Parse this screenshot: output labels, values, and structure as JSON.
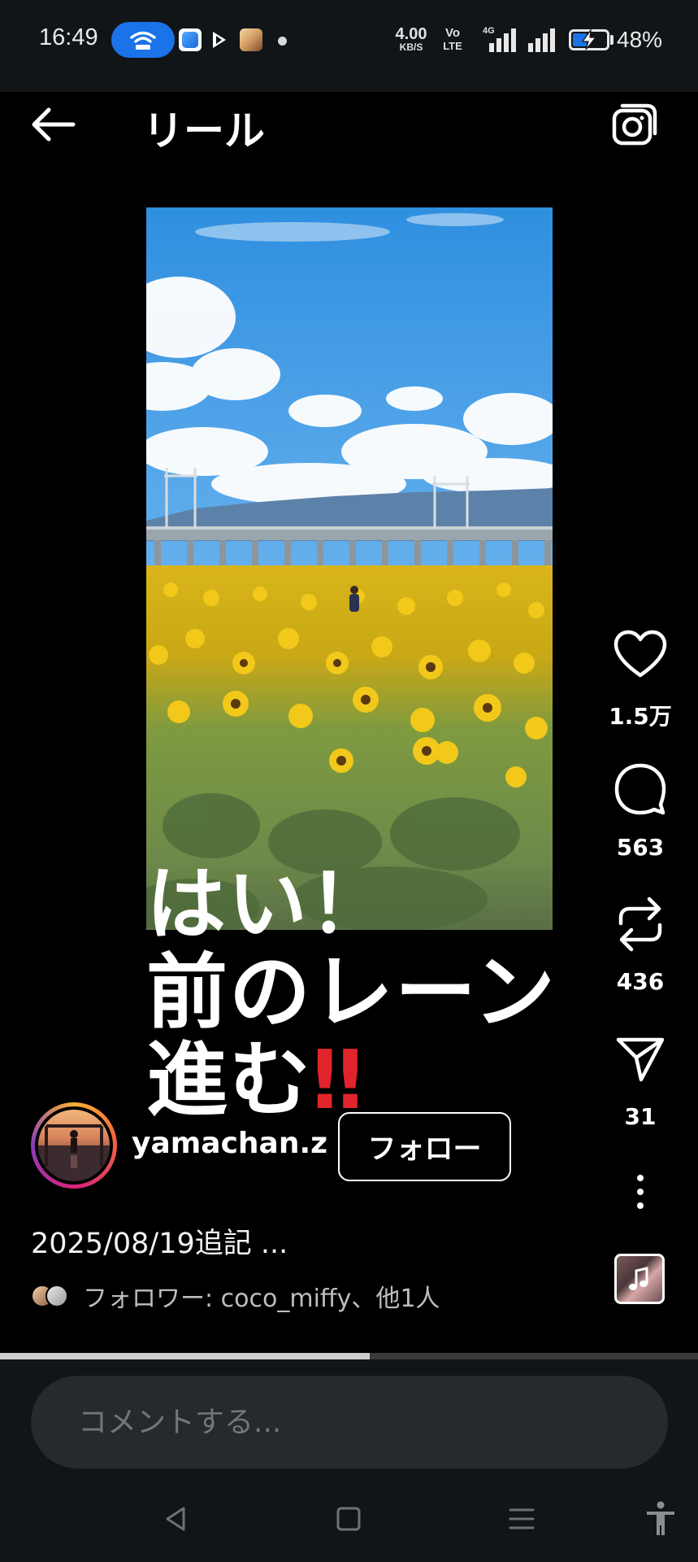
{
  "status_bar": {
    "time": "16:49",
    "net_speed_value": "4.00",
    "net_speed_unit": "KB/S",
    "volte_top": "Vo",
    "volte_bottom": "LTE",
    "network_type": "4G",
    "battery_percent_label": "48%",
    "battery_level": 0.48,
    "accent_color": "#1a73e8"
  },
  "header": {
    "title": "リール",
    "back_icon": "arrow-left-icon",
    "camera_icon": "camera-icon"
  },
  "video": {
    "overlay_caption": {
      "line1": "はい！",
      "line2": "前のレーン",
      "line3": "進む",
      "line3_emphasis": "‼"
    }
  },
  "actions": {
    "like_count": "1.5万",
    "comment_count": "563",
    "repost_count": "436",
    "share_count": "31"
  },
  "author": {
    "username": "yamachan.z",
    "follow_label": "フォロー"
  },
  "post": {
    "caption": "2025/08/19追記 ...",
    "followers_text": "フォロワー: coco_miffy、他1人"
  },
  "playback": {
    "progress": 0.53
  },
  "comment": {
    "placeholder": "コメントする..."
  }
}
